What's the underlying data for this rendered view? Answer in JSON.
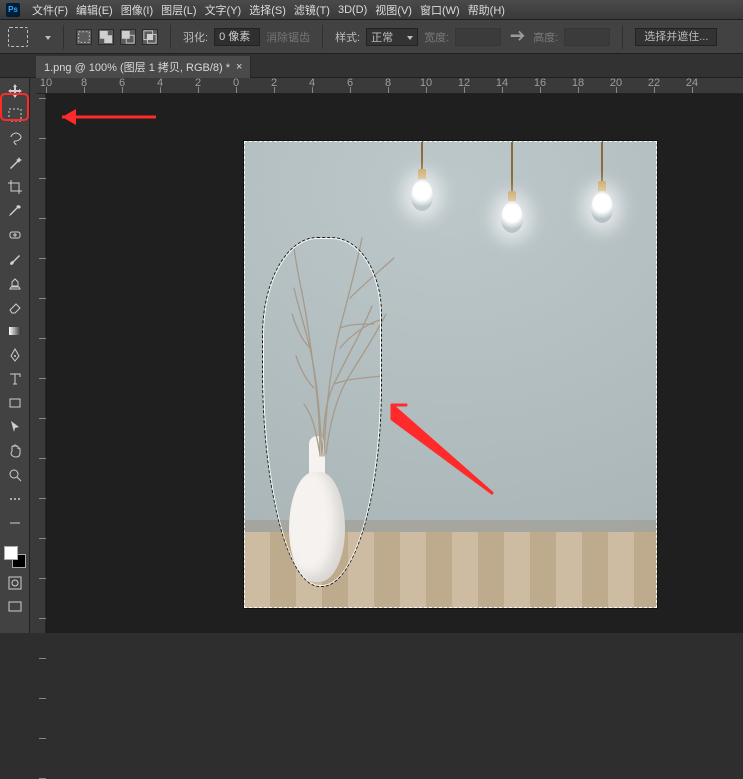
{
  "app": {
    "logo": "Ps"
  },
  "menu": {
    "file": "文件(F)",
    "edit": "编辑(E)",
    "image": "图像(I)",
    "layer": "图层(L)",
    "type": "文字(Y)",
    "select": "选择(S)",
    "filter": "滤镜(T)",
    "three": "3D(D)",
    "view": "视图(V)",
    "window": "窗口(W)",
    "help": "帮助(H)"
  },
  "options": {
    "feather_label": "羽化:",
    "feather_value": "0 像素",
    "antialias_label": "消除锯齿",
    "style_label": "样式:",
    "style_value": "正常",
    "width_label": "宽度:",
    "height_label": "高度:",
    "refine_edge": "选择并遮住..."
  },
  "tab": {
    "title": "1.png @ 100% (图层 1 拷贝, RGB/8) *",
    "close": "×"
  },
  "rulers": {
    "top": [
      "10",
      "8",
      "6",
      "4",
      "2",
      "0",
      "2",
      "4",
      "6",
      "8",
      "10",
      "12",
      "14",
      "16",
      "18",
      "20",
      "22",
      "24"
    ],
    "left_major_spacing_px": 40
  },
  "tools": {
    "marquee_highlighted": true
  }
}
